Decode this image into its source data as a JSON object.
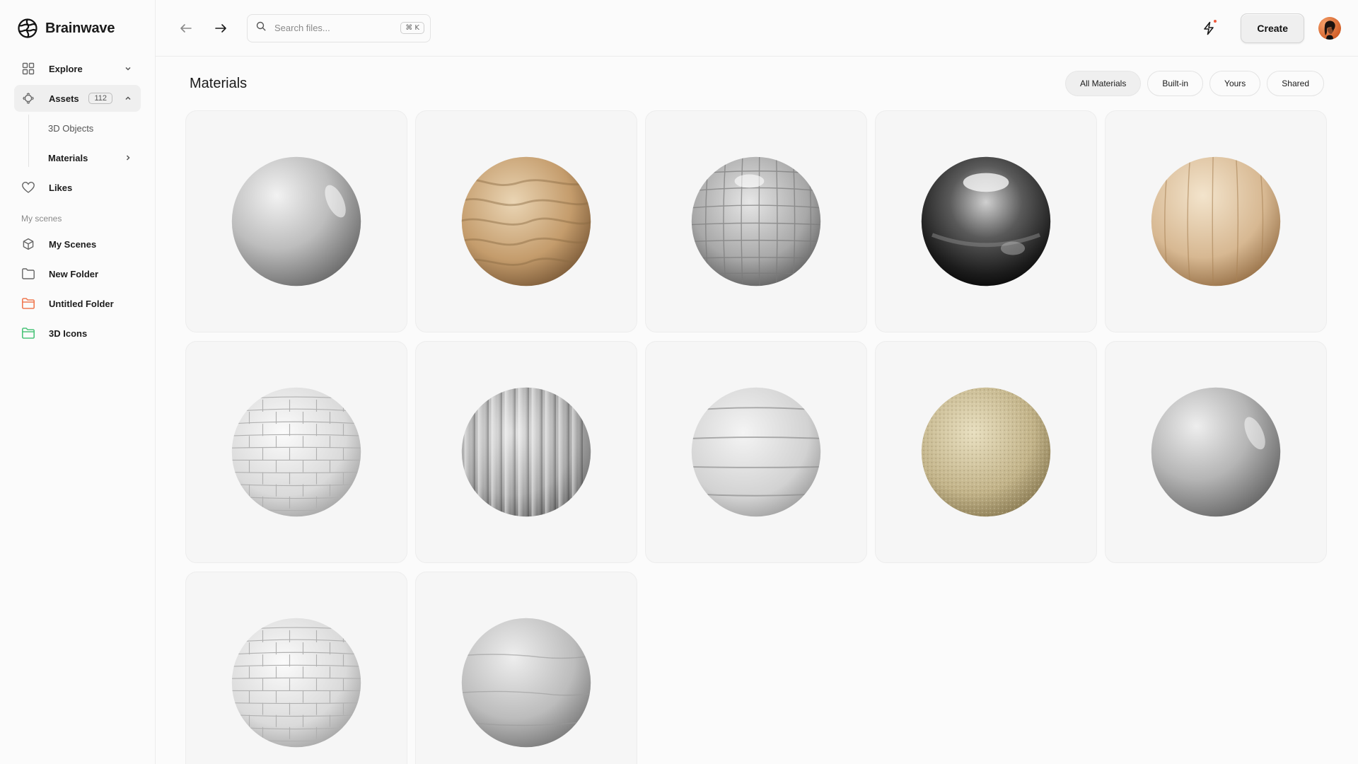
{
  "brand": {
    "name": "Brainwave"
  },
  "sidebar": {
    "nav": [
      {
        "label": "Explore",
        "icon": "grid-icon"
      },
      {
        "label": "Assets",
        "badge": "112",
        "icon": "assets-icon"
      }
    ],
    "assets_children": [
      {
        "label": "3D Objects"
      },
      {
        "label": "Materials"
      }
    ],
    "likes": {
      "label": "Likes",
      "icon": "heart-icon"
    },
    "section_title": "My scenes",
    "scenes": [
      {
        "label": "My Scenes",
        "icon": "cube-icon"
      },
      {
        "label": "New Folder",
        "icon": "folder-outline-icon"
      },
      {
        "label": "Untitled Folder",
        "icon": "folder-icon",
        "color": "#f07a52"
      },
      {
        "label": "3D Icons",
        "icon": "folder-icon",
        "color": "#4cc47a"
      }
    ]
  },
  "topbar": {
    "search_placeholder": "Search files...",
    "shortcut": "⌘ K",
    "create_label": "Create",
    "notification_color": "#ef5a3c"
  },
  "content": {
    "title": "Materials",
    "filters": [
      "All Materials",
      "Built-in",
      "Yours",
      "Shared"
    ],
    "active_filter": "All Materials",
    "materials": [
      {
        "kind": "matte-plaster-gray"
      },
      {
        "kind": "sand-dunes"
      },
      {
        "kind": "glossy-tiles"
      },
      {
        "kind": "chrome-metal"
      },
      {
        "kind": "wood-planks"
      },
      {
        "kind": "white-bricks"
      },
      {
        "kind": "ribbed-fins"
      },
      {
        "kind": "concrete-planks"
      },
      {
        "kind": "fuzzy-carpet"
      },
      {
        "kind": "matte-plaster-gray"
      },
      {
        "kind": "white-bricks"
      },
      {
        "kind": "rough-concrete"
      }
    ]
  }
}
